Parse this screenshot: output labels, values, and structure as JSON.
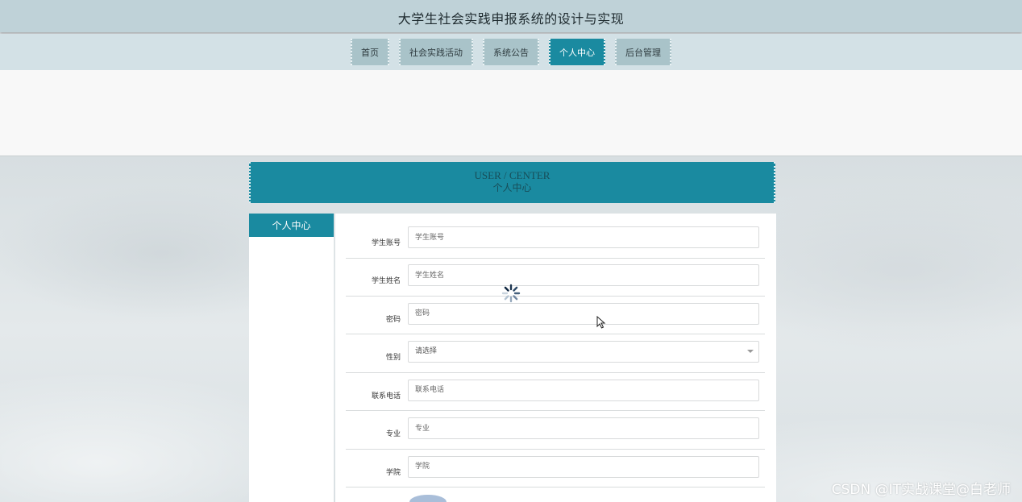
{
  "header": {
    "title": "大学生社会实践申报系统的设计与实现"
  },
  "nav": {
    "items": [
      {
        "label": "首页",
        "active": false
      },
      {
        "label": "社会实践活动",
        "active": false
      },
      {
        "label": "系统公告",
        "active": false
      },
      {
        "label": "个人中心",
        "active": true
      },
      {
        "label": "后台管理",
        "active": false
      }
    ]
  },
  "page_title": {
    "en": "USER / CENTER",
    "cn": "个人中心"
  },
  "side_menu": {
    "items": [
      {
        "label": "个人中心"
      }
    ]
  },
  "form": {
    "fields": [
      {
        "label": "学生账号",
        "placeholder": "学生账号",
        "type": "input"
      },
      {
        "label": "学生姓名",
        "placeholder": "学生姓名",
        "type": "input"
      },
      {
        "label": "密码",
        "placeholder": "密码",
        "type": "input"
      },
      {
        "label": "性别",
        "placeholder": "请选择",
        "type": "select"
      },
      {
        "label": "联系电话",
        "placeholder": "联系电话",
        "type": "input"
      },
      {
        "label": "专业",
        "placeholder": "专业",
        "type": "input"
      },
      {
        "label": "学院",
        "placeholder": "学院",
        "type": "input"
      }
    ]
  },
  "watermark": "CSDN @IT实战课堂@白老师",
  "colors": {
    "accent": "#1a8aa0",
    "header_bg": "#bfd2d8",
    "nav_bg": "#d3e1e6"
  },
  "icons": [
    "loading-spinner-icon",
    "mouse-cursor-icon",
    "chevron-down-icon"
  ]
}
